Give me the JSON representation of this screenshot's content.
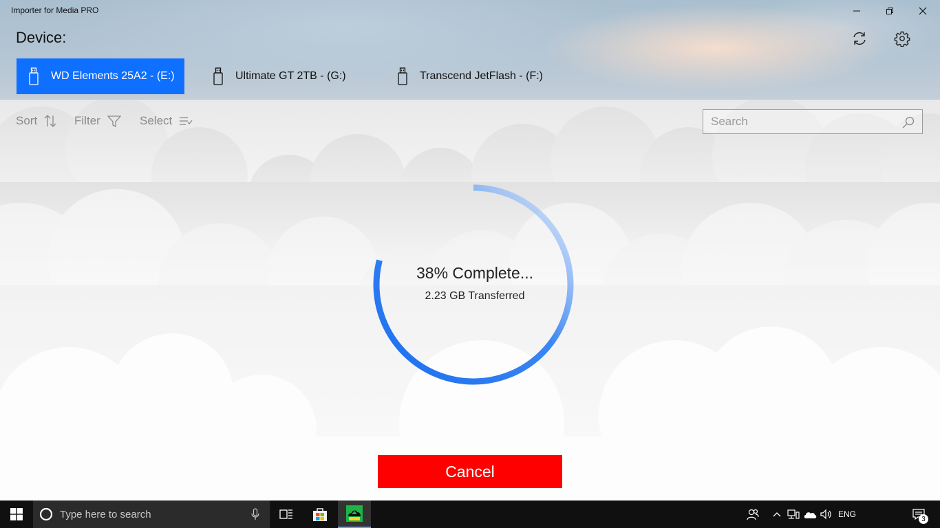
{
  "window": {
    "title": "Importer for Media PRO"
  },
  "header": {
    "device_label": "Device:",
    "devices": [
      {
        "label": "WD Elements 25A2 - (E:)",
        "active": true
      },
      {
        "label": "Ultimate GT 2TB - (G:)",
        "active": false
      },
      {
        "label": "Transcend JetFlash - (F:)",
        "active": false
      }
    ]
  },
  "toolbar": {
    "sort_label": "Sort",
    "filter_label": "Filter",
    "select_label": "Select",
    "search_placeholder": "Search"
  },
  "progress": {
    "percent": 38,
    "status_text": "38% Complete...",
    "transferred_text": "2.23 GB Transferred"
  },
  "actions": {
    "cancel_label": "Cancel"
  },
  "taskbar": {
    "search_placeholder": "Type here to search",
    "language": "ENG",
    "notification_count": "3"
  },
  "colors": {
    "accent": "#0f6fff",
    "cancel": "#ff0000",
    "taskbar": "#101010"
  },
  "icons": {
    "refresh": "refresh-icon",
    "settings": "gear-icon",
    "usb": "usb-drive-icon",
    "sort": "sort-icon",
    "filter": "filter-icon",
    "select": "select-list-icon",
    "search": "search-icon"
  }
}
